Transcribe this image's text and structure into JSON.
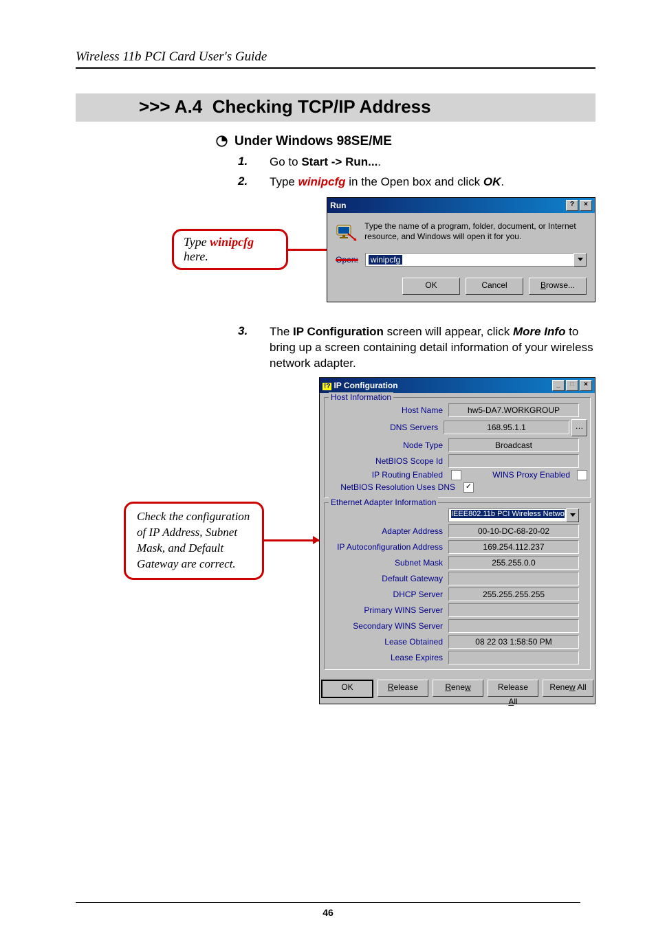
{
  "doc_header": "Wireless 11b PCI Card User's Guide",
  "section": {
    "prefix": ">>> A.4",
    "title": "Checking TCP/IP Address"
  },
  "sub": "Under Windows 98SE/ME",
  "steps": {
    "s1": {
      "num": "1.",
      "pre": "Go to ",
      "bold": "Start -> Run...",
      "post": "."
    },
    "s2": {
      "num": "2.",
      "pre": "Type ",
      "red": "winipcfg",
      "mid": " in the Open box and click ",
      "bold": "OK",
      "post": "."
    },
    "s3": {
      "num": "3.",
      "pre": "The ",
      "bold1": "IP Configuration",
      "mid1": " screen will appear, click ",
      "bold2": "More Info",
      "mid2": " to bring up a screen containing detail information of your wireless network adapter."
    }
  },
  "callout1": {
    "pre": "Type ",
    "red": "winipcfg",
    "post": " here."
  },
  "callout2": "Check the configuration of IP Address, Subnet Mask, and Default Gateway are correct.",
  "run": {
    "title": "Run",
    "desc": "Type the name of a program, folder, document, or Internet resource, and Windows will open it for you.",
    "open_label": "Open:",
    "value": "winipcfg",
    "ok": "OK",
    "cancel": "Cancel",
    "browse": "Browse..."
  },
  "ip": {
    "title": "IP Configuration",
    "group1": "Host Information",
    "group2": "Ethernet Adapter Information",
    "fields": {
      "host_name": {
        "l": "Host Name",
        "v": "hw5-DA7.WORKGROUP"
      },
      "dns": {
        "l": "DNS Servers",
        "v": "168.95.1.1"
      },
      "node": {
        "l": "Node Type",
        "v": "Broadcast"
      },
      "netbios_scope": {
        "l": "NetBIOS Scope Id",
        "v": ""
      },
      "iprouting": {
        "l": "IP Routing Enabled"
      },
      "winsproxy": {
        "l": "WINS Proxy Enabled"
      },
      "netbios_dns": {
        "l": "NetBIOS Resolution Uses DNS"
      },
      "adapter_combo": "IEEE802.11b PCI Wireless Netwo",
      "adapter_addr": {
        "l": "Adapter Address",
        "v": "00-10-DC-68-20-02"
      },
      "autoconf": {
        "l": "IP Autoconfiguration Address",
        "v": "169.254.112.237"
      },
      "subnet": {
        "l": "Subnet Mask",
        "v": "255.255.0.0"
      },
      "gateway": {
        "l": "Default Gateway",
        "v": ""
      },
      "dhcp": {
        "l": "DHCP Server",
        "v": "255.255.255.255"
      },
      "pwins": {
        "l": "Primary WINS Server",
        "v": ""
      },
      "swins": {
        "l": "Secondary WINS Server",
        "v": ""
      },
      "lease_obt": {
        "l": "Lease Obtained",
        "v": "08 22 03 1:58:50 PM"
      },
      "lease_exp": {
        "l": "Lease Expires",
        "v": ""
      }
    },
    "btns": {
      "ok": "OK",
      "release": "Release",
      "renew": "Renew",
      "release_all": "Release All",
      "renew_all": "Renew All"
    }
  },
  "page_num": "46"
}
